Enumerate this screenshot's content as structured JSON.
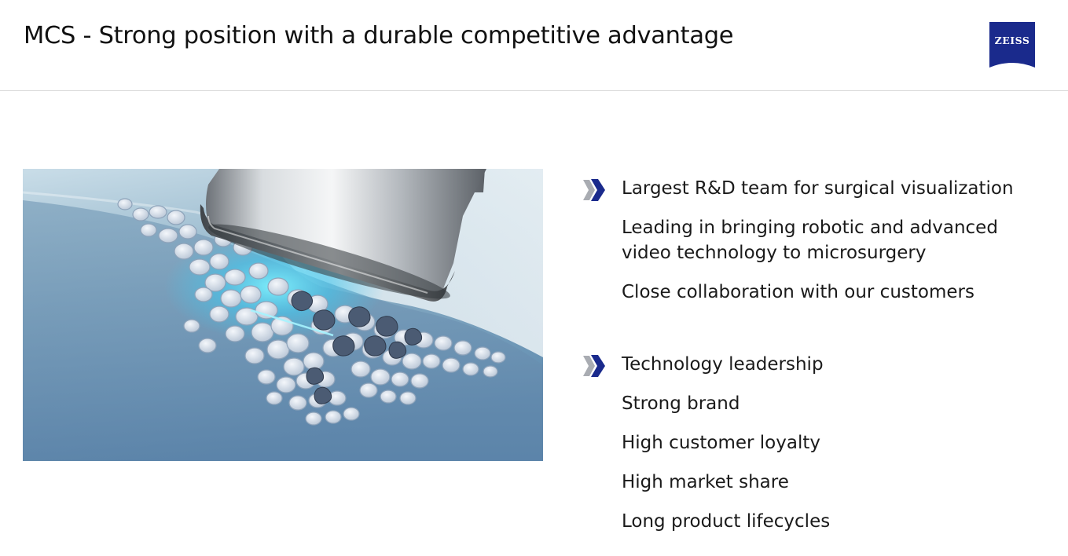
{
  "header": {
    "title": "MCS - Strong position with a durable competitive advantage",
    "logo_text": "ZEISS",
    "brand_color": "#1a2a8c"
  },
  "visual": {
    "icon": "surgical-microscope-illustration"
  },
  "groups": [
    {
      "icon": "chevron-right-icon",
      "items": [
        "Largest R&D team for surgical visualization",
        "Leading in bringing robotic and advanced",
        "video technology to microsurgery",
        "Close collaboration with our customers"
      ]
    },
    {
      "icon": "chevron-right-icon",
      "items": [
        "Technology leadership",
        "Strong brand",
        "High customer loyalty",
        "High market share",
        "Long product lifecycles"
      ]
    }
  ]
}
